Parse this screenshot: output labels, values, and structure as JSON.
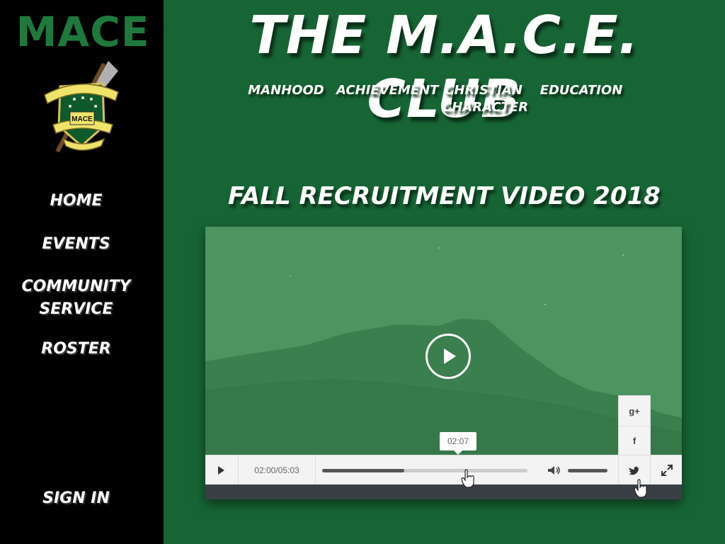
{
  "sidebar": {
    "logo_text": "MACE",
    "crest_text": "MACE",
    "nav": [
      {
        "label": "HOME"
      },
      {
        "label": "EVENTS"
      },
      {
        "label": "COMMUNITY"
      },
      {
        "label": "SERVICE"
      },
      {
        "label": "ROSTER"
      }
    ],
    "sign_in": "SIGN IN"
  },
  "header": {
    "title": "THE M.A.C.E. CLUB",
    "pillars": [
      "MANHOOD",
      "ACHIEVEMENT",
      "CHRISTIAN",
      "CHARACTER",
      "EDUCATION"
    ]
  },
  "video": {
    "title": "FALL RECRUITMENT VIDEO 2018",
    "time_display": "02:00/05:03",
    "tooltip_time": "02:07",
    "progress_fraction": 0.4,
    "share": {
      "google": "g+",
      "facebook": "f"
    }
  },
  "colors": {
    "background": "#176535",
    "sidebar": "#000000",
    "logo_green": "#1e7a3c",
    "player_tint": "#4c9460"
  }
}
